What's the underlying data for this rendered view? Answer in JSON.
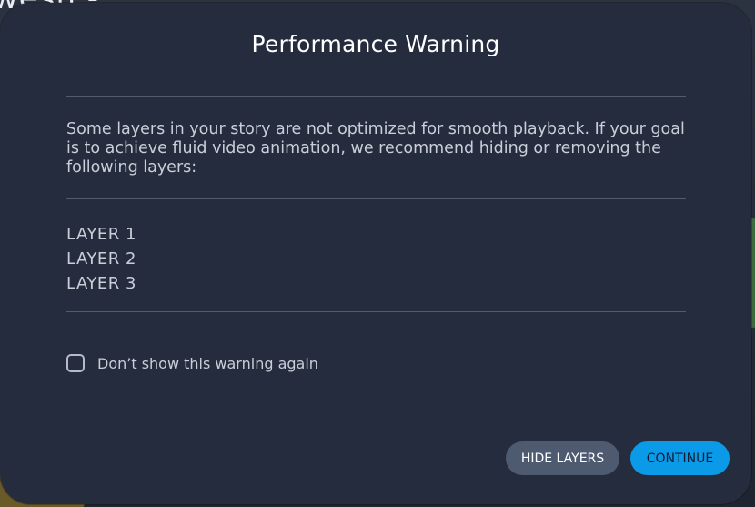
{
  "background": {
    "partial_title": "wesh - ..."
  },
  "dialog": {
    "title": "Performance Warning",
    "message": "Some layers in your story are not optimized for smooth playback. If your goal is to achieve fluid video animation, we recommend hiding or removing the following layers:",
    "layers": [
      "LAYER 1",
      "LAYER 2",
      "LAYER 3"
    ],
    "checkbox_label": "Don’t show this warning again",
    "checkbox_checked": false,
    "buttons": {
      "hide_layers": "HIDE LAYERS",
      "continue": "CONTINUE"
    }
  },
  "colors": {
    "dialog_bg": "#252c3d",
    "primary_button": "#0a9ae8",
    "secondary_button": "#4e5a70"
  }
}
